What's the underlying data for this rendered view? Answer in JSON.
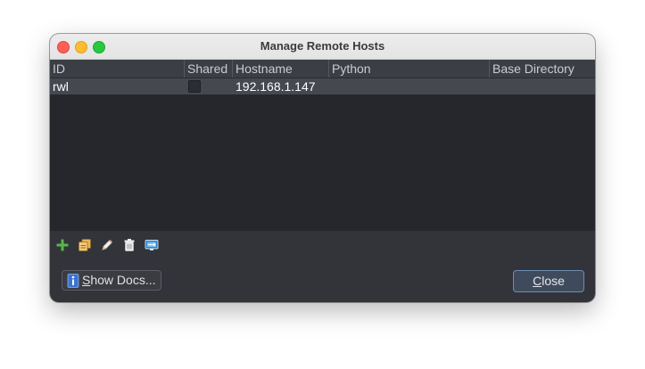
{
  "window": {
    "title": "Manage Remote Hosts"
  },
  "table": {
    "columns": [
      "ID",
      "Shared",
      "Hostname",
      "Python",
      "Base Directory"
    ],
    "rows": [
      {
        "id": "rwl",
        "shared": false,
        "hostname": "192.168.1.147",
        "python": "",
        "base_directory": ""
      }
    ]
  },
  "toolbar": {
    "icons": [
      "add-icon",
      "duplicate-icon",
      "edit-icon",
      "delete-icon",
      "monitor-icon"
    ]
  },
  "buttons": {
    "show_docs_mnemonic": "S",
    "show_docs_rest": "how Docs...",
    "close_mnemonic": "C",
    "close_rest": "lose"
  },
  "colors": {
    "accent": "#6e8db5",
    "window_bg": "#32343a",
    "table_bg": "#25272d",
    "selected_row": "#45484f"
  }
}
